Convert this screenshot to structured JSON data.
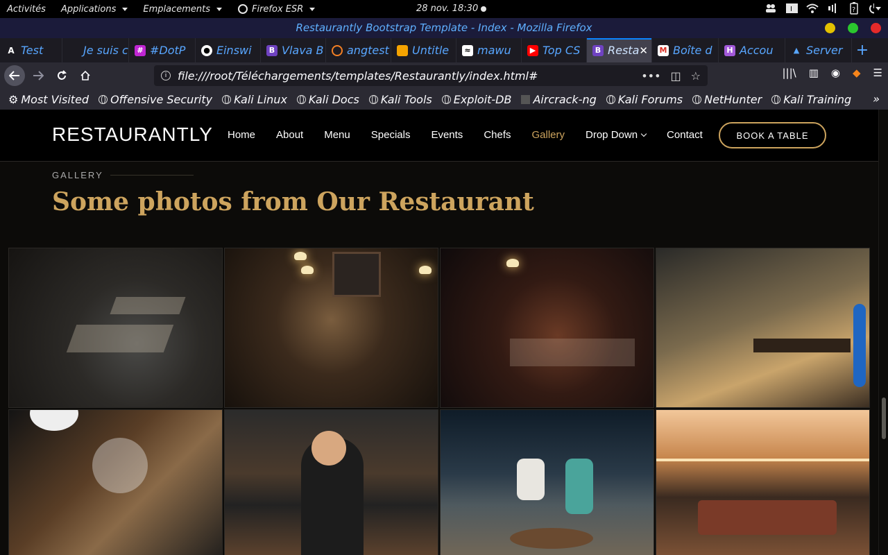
{
  "gnome": {
    "activities": "Activités",
    "applications": "Applications",
    "places": "Emplacements",
    "app_name": "Firefox ESR",
    "clock": "28 nov.  18:30",
    "battery": "?"
  },
  "window": {
    "title": "Restaurantly Bootstrap Template - Index - Mozilla Firefox"
  },
  "tabs": [
    {
      "label": "Test",
      "icon": "A"
    },
    {
      "label": "Je suis ca",
      "icon": ""
    },
    {
      "label": "#DotP",
      "icon": "H"
    },
    {
      "label": "Einswi",
      "icon": "github"
    },
    {
      "label": "Vlava B",
      "icon": "B"
    },
    {
      "label": "angtest",
      "icon": "o"
    },
    {
      "label": "Untitle",
      "icon": "doc"
    },
    {
      "label": "mawu",
      "icon": "f"
    },
    {
      "label": "Top CS",
      "icon": "yt"
    },
    {
      "label": "Resta",
      "icon": "B",
      "active": true
    },
    {
      "label": "Boîte d",
      "icon": "M"
    },
    {
      "label": "Accou",
      "icon": "K"
    },
    {
      "label": "Server",
      "icon": "warn"
    }
  ],
  "urlbar": {
    "url": "file:///root/Téléchargements/templates/Restaurantly/index.html#"
  },
  "bookmarks": [
    "Most Visited",
    "Offensive Security",
    "Kali Linux",
    "Kali Docs",
    "Kali Tools",
    "Exploit-DB",
    "Aircrack-ng",
    "Kali Forums",
    "NetHunter",
    "Kali Training"
  ],
  "site": {
    "logo": "RESTAURANTLY",
    "menu": [
      "Home",
      "About",
      "Menu",
      "Specials",
      "Events",
      "Chefs",
      "Gallery",
      "Drop Down",
      "Contact"
    ],
    "active_menu": "Gallery",
    "book_button": "BOOK A TABLE",
    "section_label": "GALLERY",
    "section_title": "Some photos from Our Restaurant"
  },
  "colors": {
    "accent": "#cda45e",
    "background": "#0c0b09",
    "header": "#000000"
  }
}
